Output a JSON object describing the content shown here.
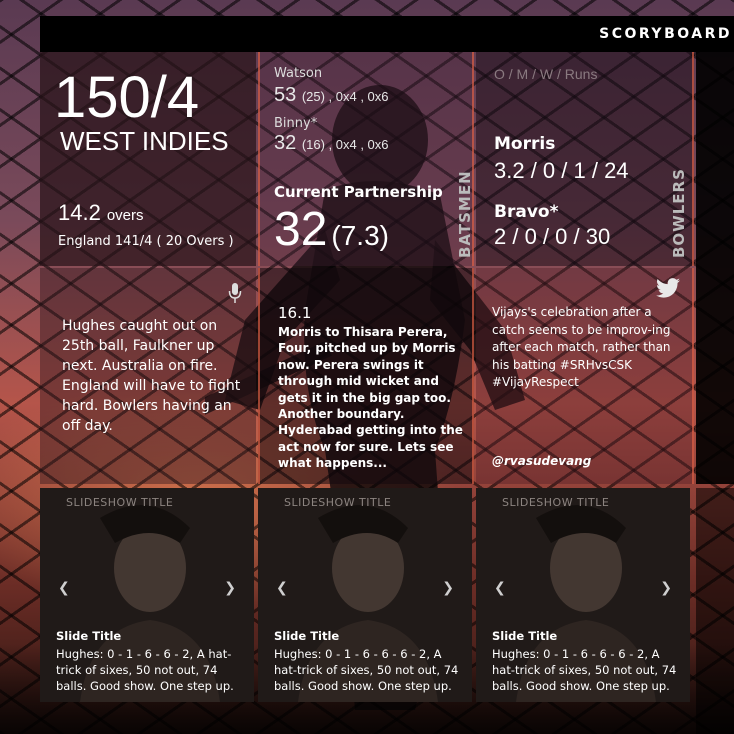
{
  "brand": "SCORYBOARD",
  "score": {
    "runs_wickets": "150/4",
    "team": "WEST INDIES",
    "overs_value": "14.2",
    "overs_label": "overs",
    "target": "England 141/4 ( 20 Overs )"
  },
  "batsmen": {
    "section_label": "BATSMEN",
    "players": [
      {
        "name": "Watson",
        "runs": "53",
        "details": "(25) , 0x4 , 0x6"
      },
      {
        "name": "Binny*",
        "runs": "32",
        "details": "(16) , 0x4 , 0x6"
      }
    ],
    "partnership_label": "Current Partnership",
    "partnership_runs": "32",
    "partnership_rate": "(7.3)"
  },
  "bowlers": {
    "section_label": "BOWLERS",
    "header": "O / M / W / Runs",
    "players": [
      {
        "name": "Morris",
        "figures": "3.2 / 0 / 1 / 24"
      },
      {
        "name": "Bravo*",
        "figures": "2 / 0 / 0 / 30"
      }
    ]
  },
  "voice_comment": {
    "icon": "microphone-icon",
    "text": "Hughes caught out on 25th ball, Faulkner up next. Australia on fire. England will have to fight hard. Bowlers having an off day."
  },
  "commentary": {
    "over": "16.1",
    "text": "Morris to Thisara Perera, Four, pitched up by Morris now. Perera swings it through mid wicket and gets it in the big gap too. Another boundary. Hyderabad getting into the act now for sure. Lets see what happens..."
  },
  "tweet": {
    "icon": "twitter-bird-icon",
    "text": "Vijays's celebration after a catch seems to be improv-ing after each match, rather than his batting #SRHvsCSK #VijayRespect",
    "handle": "@rvasudevang"
  },
  "slides": [
    {
      "title": "SLIDESHOW TITLE",
      "slide_title": "Slide Title",
      "caption": "Hughes: 0 - 1 - 6 - 6 - 2, A hat-trick of sixes, 50 not out, 74 balls. Good show. One step up."
    },
    {
      "title": "SLIDESHOW TITLE",
      "slide_title": "Slide Title",
      "caption": "Hughes: 0 - 1 - 6 - 6 - 6 - 2, A hat-trick of sixes, 50 not out, 74 balls. Good show. One step up."
    },
    {
      "title": "SLIDESHOW TITLE",
      "slide_title": "Slide Title",
      "caption": "Hughes: 0 - 1 - 6 - 6 - 6 - 2, A hat-trick of sixes, 50 not out, 74 balls. Good show. One step up."
    }
  ],
  "colors": {
    "accent_border": "#e66446",
    "topbar": "#000000"
  }
}
